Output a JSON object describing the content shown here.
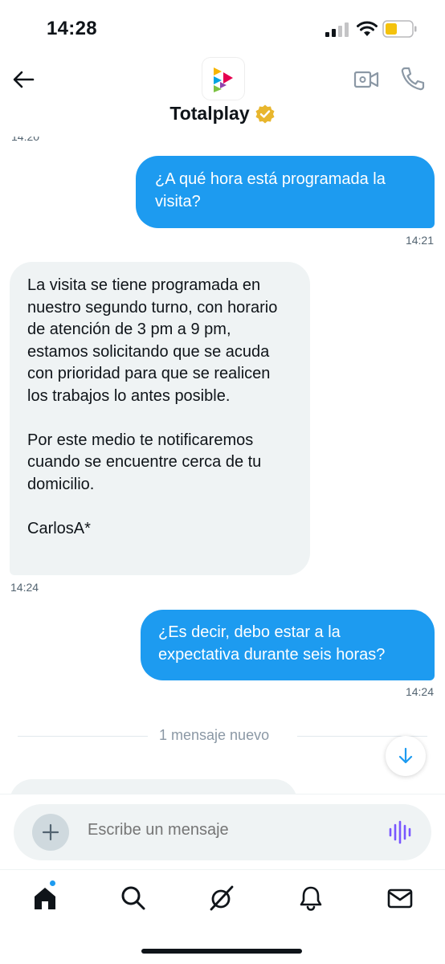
{
  "status_bar": {
    "time": "14:28",
    "icons": [
      "cellular-signal-icon",
      "wifi-icon",
      "battery-low-icon"
    ],
    "battery_color": "#f4c20d"
  },
  "header": {
    "title": "Totalplay",
    "icons": [
      "back-arrow-icon",
      "totalplay-logo",
      "verified-badge-icon",
      "video-call-icon",
      "phone-call-icon"
    ],
    "verified_color": "#e8b62d"
  },
  "conversation": {
    "cut_timestamp": "14:20",
    "messages": [
      {
        "direction": "out",
        "text": "¿A qué hora está programada la visita?",
        "time": "14:21"
      },
      {
        "direction": "in",
        "text": "La visita se tiene programada en nuestro segundo turno, con horario de atención de 3 pm a 9 pm, estamos solicitando que se acuda con prioridad para que se realicen los trabajos lo antes posible.\n\nPor este medio te notificaremos cuando se encuentre cerca de tu domicilio.\n\nCarlosA*",
        "time": "14:24"
      },
      {
        "direction": "out",
        "text": "¿Es decir, debo estar a la expectativa durante seis horas?",
        "time": "14:24"
      }
    ],
    "new_messages_divider": "1 mensaje nuevo"
  },
  "composer": {
    "placeholder": "Escribe un mensaje",
    "icons": [
      "plus-icon",
      "voice-message-icon"
    ],
    "voice_color": "#7856ff"
  },
  "bottom_nav": {
    "items": [
      "home-icon",
      "search-icon",
      "grok-icon",
      "notifications-icon",
      "messages-icon"
    ],
    "accent": "#1d9bf0"
  }
}
